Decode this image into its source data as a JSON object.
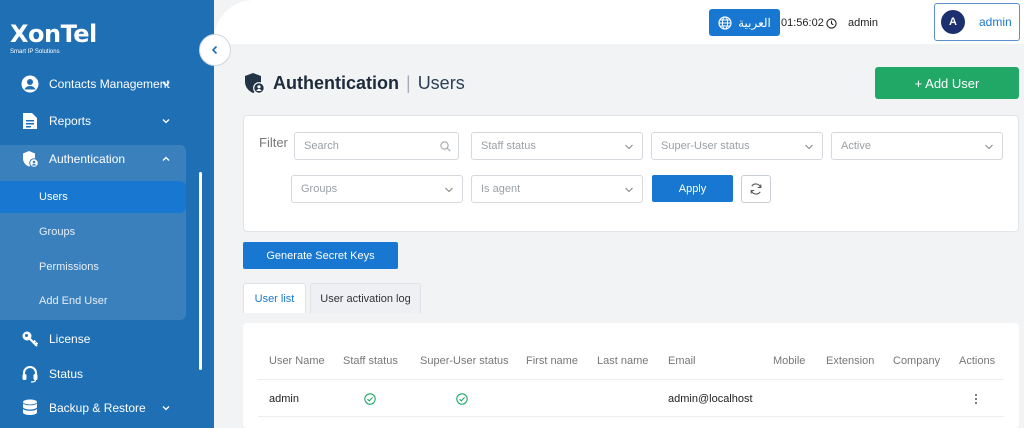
{
  "brand": {
    "name": "XonTel",
    "tagline": "Smart IP Solutions"
  },
  "sidebar": {
    "items": [
      {
        "label": "Contacts Management",
        "icon": "contacts-icon"
      },
      {
        "label": "Reports",
        "icon": "reports-icon"
      },
      {
        "label": "Authentication",
        "icon": "shield-user-icon"
      },
      {
        "label": "License",
        "icon": "key-icon"
      },
      {
        "label": "Status",
        "icon": "headset-icon"
      },
      {
        "label": "Backup & Restore",
        "icon": "database-icon"
      }
    ],
    "submenu": [
      {
        "label": "Users",
        "active": true
      },
      {
        "label": "Groups"
      },
      {
        "label": "Permissions"
      },
      {
        "label": "Add End User"
      }
    ]
  },
  "topbar": {
    "language_label": "العربية",
    "time": "01:56:02",
    "username": "admin",
    "avatar_letter": "A",
    "user_chip_name": "admin"
  },
  "page": {
    "title": "Authentication",
    "subtitle": "Users",
    "add_button": "+ Add User"
  },
  "filter": {
    "label": "Filter",
    "search_placeholder": "Search",
    "staff_status": "Staff status",
    "superuser_status": "Super-User status",
    "active": "Active",
    "groups": "Groups",
    "is_agent": "Is agent",
    "apply": "Apply"
  },
  "actions": {
    "generate_secret": "Generate Secret Keys"
  },
  "tabs": {
    "user_list": "User list",
    "activation_log": "User activation log"
  },
  "table": {
    "headers": [
      "User Name",
      "Staff status",
      "Super-User status",
      "First name",
      "Last name",
      "Email",
      "Mobile",
      "Extension",
      "Company",
      "Actions"
    ],
    "rows": [
      {
        "username": "admin",
        "staff": true,
        "superuser": true,
        "first": "",
        "last": "",
        "email": "admin@localhost",
        "mobile": "",
        "extension": "",
        "company": ""
      }
    ]
  },
  "colors": {
    "sidebar": "#1e6fb4",
    "primary": "#1877d0",
    "success": "#21a866"
  }
}
